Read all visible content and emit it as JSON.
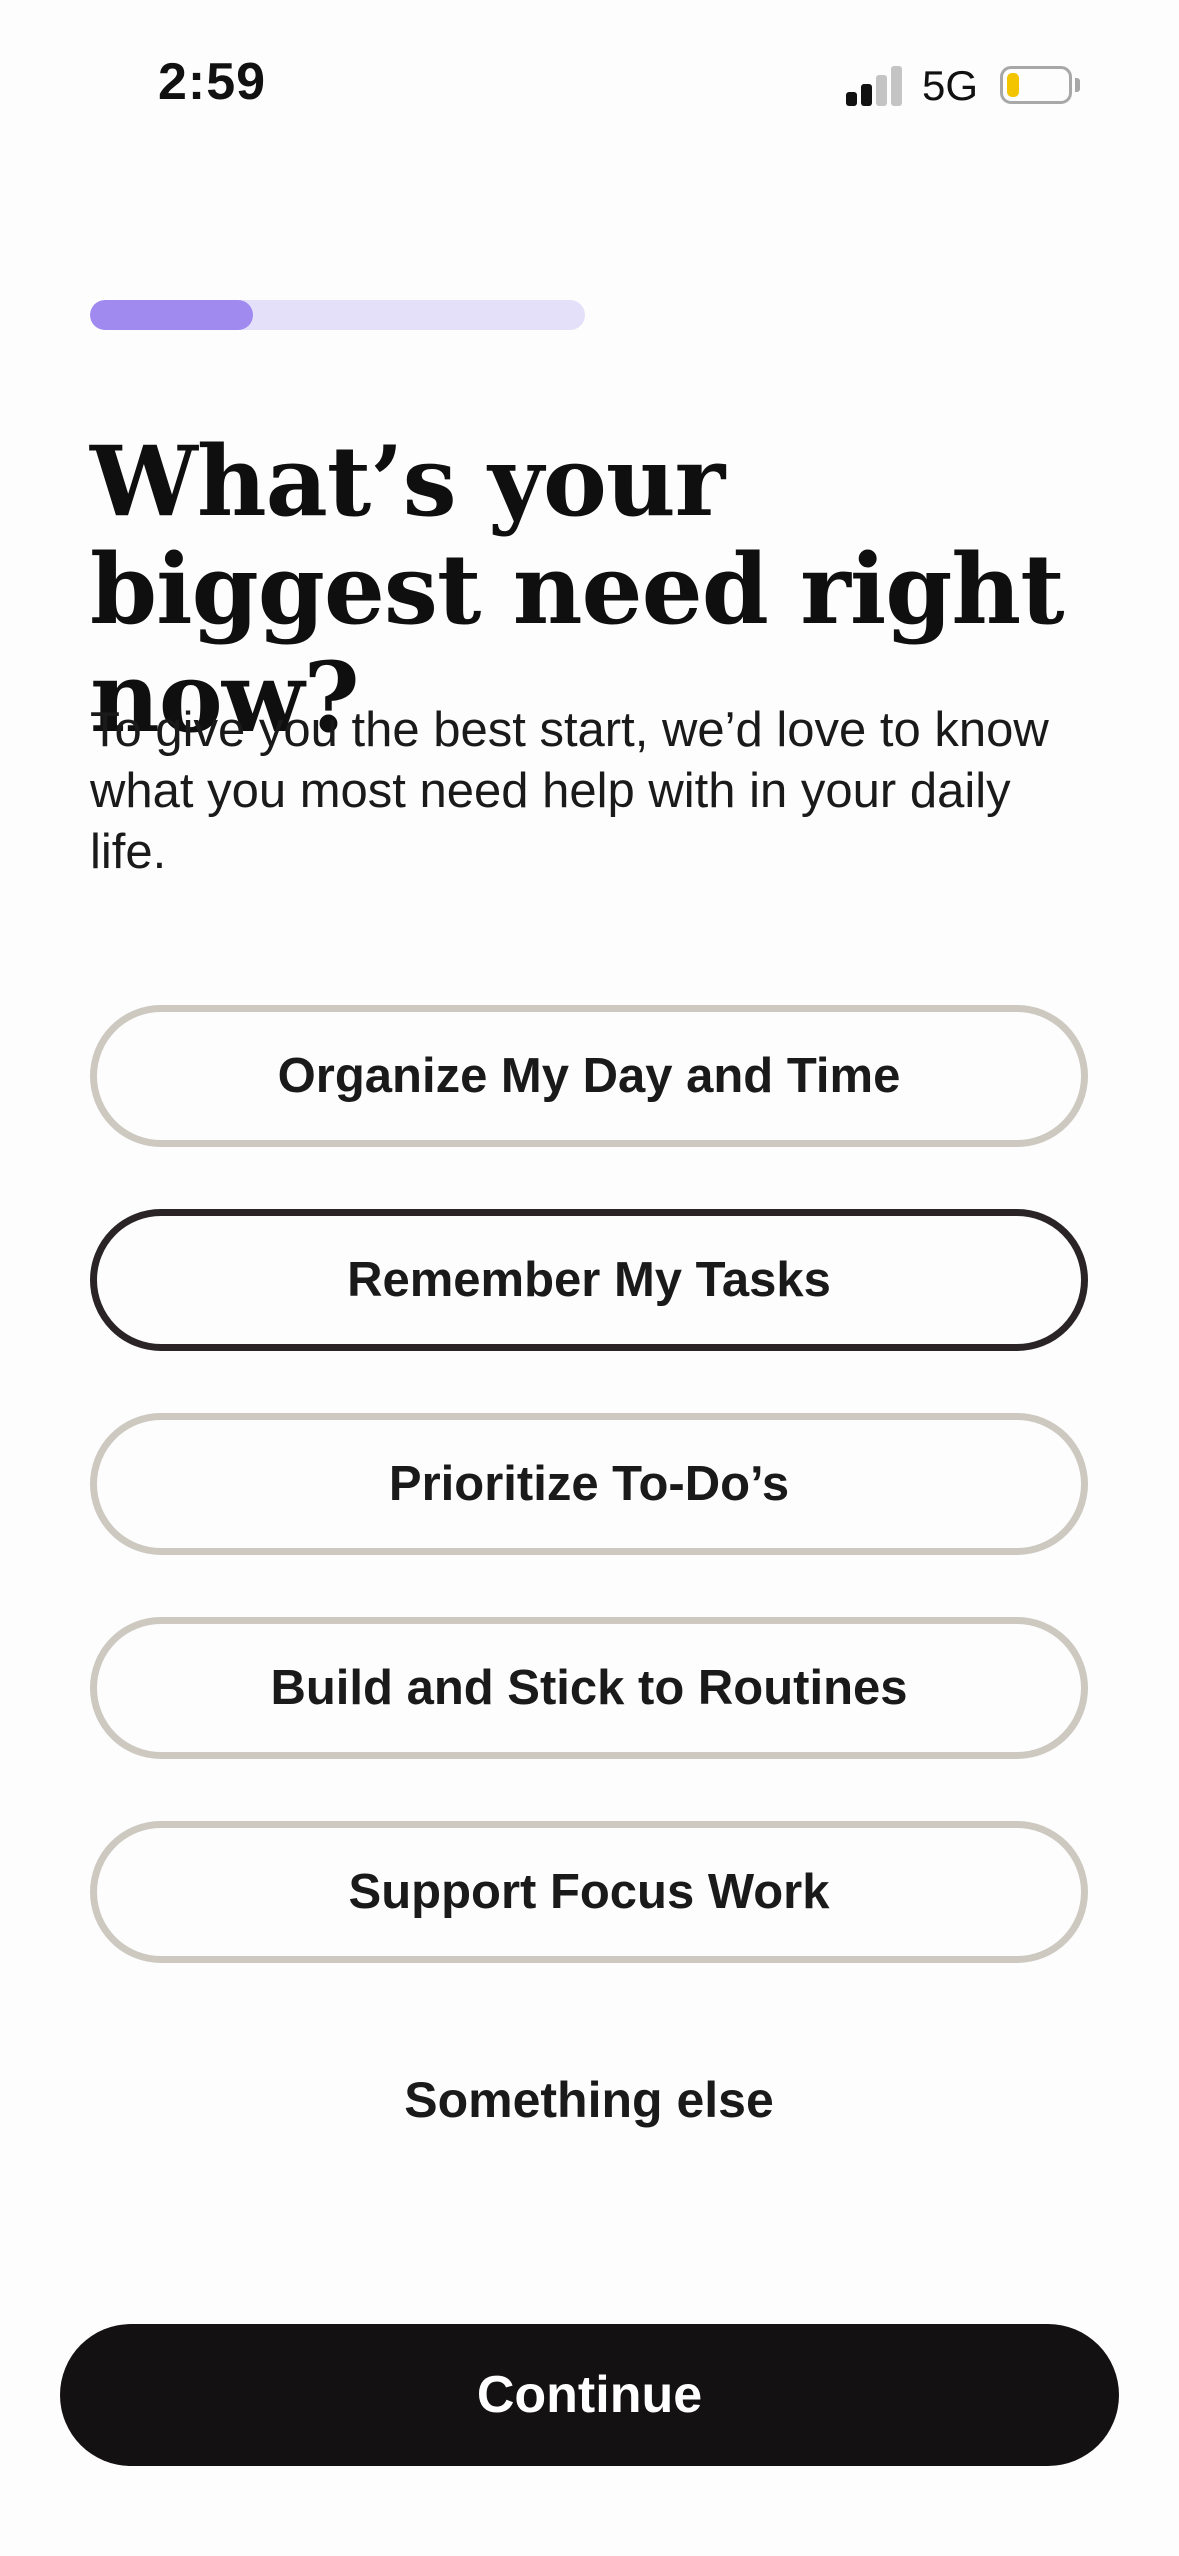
{
  "status_bar": {
    "time": "2:59",
    "network": "5G",
    "signal_bars_active": 2,
    "signal_bars_total": 4,
    "battery_level": 0.2,
    "battery_color": "#f2c500",
    "signal_active_color": "#111111",
    "signal_inactive_color": "#c4c4c4"
  },
  "progress": {
    "value": 0.33,
    "track_color": "#e4e0fa",
    "fill_color": "#a08af0"
  },
  "title": "What’s your biggest need right now?",
  "subtitle": "To give you the best start, we’d love to know what you most need help with in your daily life.",
  "options": [
    {
      "label": "Organize My Day and Time",
      "selected": false
    },
    {
      "label": "Remember My Tasks",
      "selected": true
    },
    {
      "label": "Prioritize To-Do’s",
      "selected": false
    },
    {
      "label": "Build and Stick to Routines",
      "selected": false
    },
    {
      "label": "Support Focus Work",
      "selected": false
    }
  ],
  "something_else_label": "Something else",
  "continue_label": "Continue"
}
